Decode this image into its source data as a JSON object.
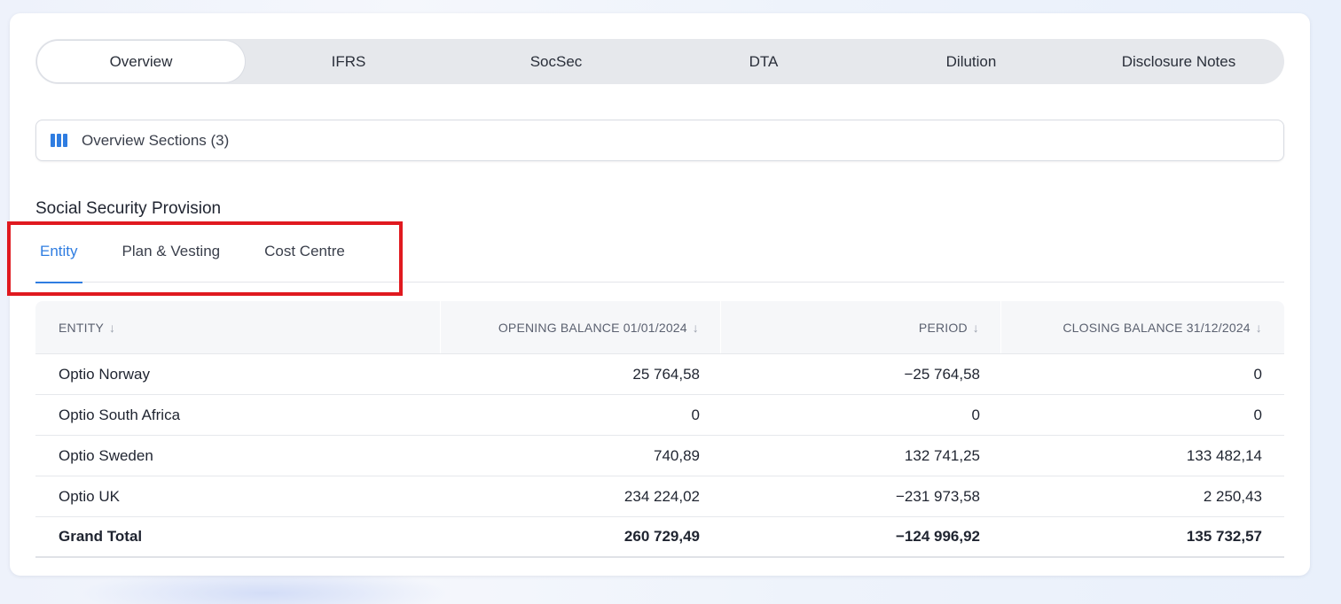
{
  "tabs": [
    {
      "label": "Overview",
      "active": true
    },
    {
      "label": "IFRS",
      "active": false
    },
    {
      "label": "SocSec",
      "active": false
    },
    {
      "label": "DTA",
      "active": false
    },
    {
      "label": "Dilution",
      "active": false
    },
    {
      "label": "Disclosure Notes",
      "active": false
    }
  ],
  "sections_bar": {
    "label": "Overview Sections (3)",
    "icon": "columns-icon"
  },
  "section_title": "Social Security Provision",
  "subtabs": [
    {
      "label": "Entity",
      "active": true
    },
    {
      "label": "Plan & Vesting",
      "active": false
    },
    {
      "label": "Cost Centre",
      "active": false
    }
  ],
  "table": {
    "columns": [
      "ENTITY",
      "OPENING BALANCE 01/01/2024",
      "PERIOD",
      "CLOSING BALANCE 31/12/2024"
    ],
    "sort_icon": "arrow-down-icon",
    "rows": [
      [
        "Optio Norway",
        "25 764,58",
        "−25 764,58",
        "0"
      ],
      [
        "Optio South Africa",
        "0",
        "0",
        "0"
      ],
      [
        "Optio Sweden",
        "740,89",
        "132 741,25",
        "133 482,14"
      ],
      [
        "Optio UK",
        "234 224,02",
        "−231 973,58",
        "2 250,43"
      ]
    ],
    "total": [
      "Grand Total",
      "260 729,49",
      "−124 996,92",
      "135 732,57"
    ]
  },
  "colors": {
    "accent": "#2f7de1",
    "highlight": "#e0191f"
  }
}
